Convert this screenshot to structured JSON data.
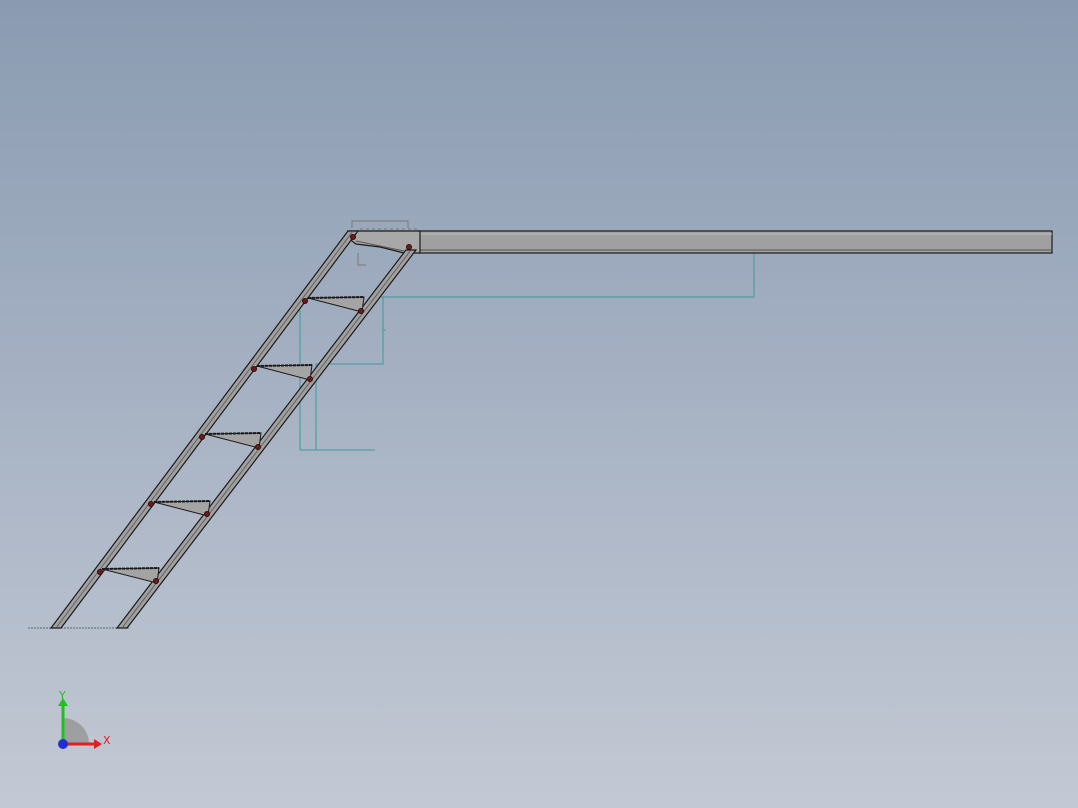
{
  "viewport": {
    "background_top": "#8a9bb1",
    "background_bottom": "#c3c9d4"
  },
  "model": {
    "part_fill": "#a0a0a0",
    "part_edge": "#1a1a1a",
    "bolt_color": "#6b1a1a",
    "sketch_color": "#3c9a9a",
    "tread_count": 5
  },
  "triad": {
    "x_label": "X",
    "y_label": "Y",
    "x_color": "#e02020",
    "y_color": "#20c020",
    "z_color": "#2030d0"
  }
}
